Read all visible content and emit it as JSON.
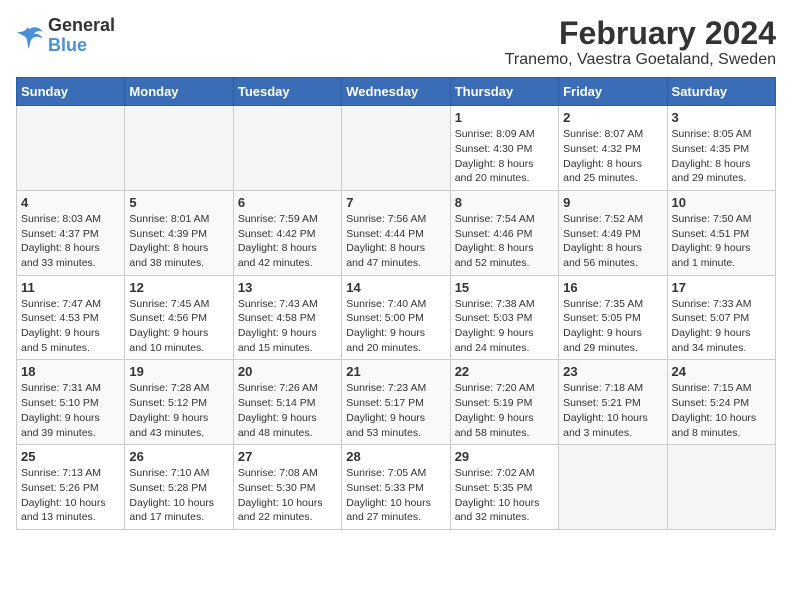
{
  "header": {
    "logo_general": "General",
    "logo_blue": "Blue",
    "title": "February 2024",
    "subtitle": "Tranemo, Vaestra Goetaland, Sweden"
  },
  "weekdays": [
    "Sunday",
    "Monday",
    "Tuesday",
    "Wednesday",
    "Thursday",
    "Friday",
    "Saturday"
  ],
  "weeks": [
    [
      {
        "day": "",
        "info": ""
      },
      {
        "day": "",
        "info": ""
      },
      {
        "day": "",
        "info": ""
      },
      {
        "day": "",
        "info": ""
      },
      {
        "day": "1",
        "info": "Sunrise: 8:09 AM\nSunset: 4:30 PM\nDaylight: 8 hours\nand 20 minutes."
      },
      {
        "day": "2",
        "info": "Sunrise: 8:07 AM\nSunset: 4:32 PM\nDaylight: 8 hours\nand 25 minutes."
      },
      {
        "day": "3",
        "info": "Sunrise: 8:05 AM\nSunset: 4:35 PM\nDaylight: 8 hours\nand 29 minutes."
      }
    ],
    [
      {
        "day": "4",
        "info": "Sunrise: 8:03 AM\nSunset: 4:37 PM\nDaylight: 8 hours\nand 33 minutes."
      },
      {
        "day": "5",
        "info": "Sunrise: 8:01 AM\nSunset: 4:39 PM\nDaylight: 8 hours\nand 38 minutes."
      },
      {
        "day": "6",
        "info": "Sunrise: 7:59 AM\nSunset: 4:42 PM\nDaylight: 8 hours\nand 42 minutes."
      },
      {
        "day": "7",
        "info": "Sunrise: 7:56 AM\nSunset: 4:44 PM\nDaylight: 8 hours\nand 47 minutes."
      },
      {
        "day": "8",
        "info": "Sunrise: 7:54 AM\nSunset: 4:46 PM\nDaylight: 8 hours\nand 52 minutes."
      },
      {
        "day": "9",
        "info": "Sunrise: 7:52 AM\nSunset: 4:49 PM\nDaylight: 8 hours\nand 56 minutes."
      },
      {
        "day": "10",
        "info": "Sunrise: 7:50 AM\nSunset: 4:51 PM\nDaylight: 9 hours\nand 1 minute."
      }
    ],
    [
      {
        "day": "11",
        "info": "Sunrise: 7:47 AM\nSunset: 4:53 PM\nDaylight: 9 hours\nand 5 minutes."
      },
      {
        "day": "12",
        "info": "Sunrise: 7:45 AM\nSunset: 4:56 PM\nDaylight: 9 hours\nand 10 minutes."
      },
      {
        "day": "13",
        "info": "Sunrise: 7:43 AM\nSunset: 4:58 PM\nDaylight: 9 hours\nand 15 minutes."
      },
      {
        "day": "14",
        "info": "Sunrise: 7:40 AM\nSunset: 5:00 PM\nDaylight: 9 hours\nand 20 minutes."
      },
      {
        "day": "15",
        "info": "Sunrise: 7:38 AM\nSunset: 5:03 PM\nDaylight: 9 hours\nand 24 minutes."
      },
      {
        "day": "16",
        "info": "Sunrise: 7:35 AM\nSunset: 5:05 PM\nDaylight: 9 hours\nand 29 minutes."
      },
      {
        "day": "17",
        "info": "Sunrise: 7:33 AM\nSunset: 5:07 PM\nDaylight: 9 hours\nand 34 minutes."
      }
    ],
    [
      {
        "day": "18",
        "info": "Sunrise: 7:31 AM\nSunset: 5:10 PM\nDaylight: 9 hours\nand 39 minutes."
      },
      {
        "day": "19",
        "info": "Sunrise: 7:28 AM\nSunset: 5:12 PM\nDaylight: 9 hours\nand 43 minutes."
      },
      {
        "day": "20",
        "info": "Sunrise: 7:26 AM\nSunset: 5:14 PM\nDaylight: 9 hours\nand 48 minutes."
      },
      {
        "day": "21",
        "info": "Sunrise: 7:23 AM\nSunset: 5:17 PM\nDaylight: 9 hours\nand 53 minutes."
      },
      {
        "day": "22",
        "info": "Sunrise: 7:20 AM\nSunset: 5:19 PM\nDaylight: 9 hours\nand 58 minutes."
      },
      {
        "day": "23",
        "info": "Sunrise: 7:18 AM\nSunset: 5:21 PM\nDaylight: 10 hours\nand 3 minutes."
      },
      {
        "day": "24",
        "info": "Sunrise: 7:15 AM\nSunset: 5:24 PM\nDaylight: 10 hours\nand 8 minutes."
      }
    ],
    [
      {
        "day": "25",
        "info": "Sunrise: 7:13 AM\nSunset: 5:26 PM\nDaylight: 10 hours\nand 13 minutes."
      },
      {
        "day": "26",
        "info": "Sunrise: 7:10 AM\nSunset: 5:28 PM\nDaylight: 10 hours\nand 17 minutes."
      },
      {
        "day": "27",
        "info": "Sunrise: 7:08 AM\nSunset: 5:30 PM\nDaylight: 10 hours\nand 22 minutes."
      },
      {
        "day": "28",
        "info": "Sunrise: 7:05 AM\nSunset: 5:33 PM\nDaylight: 10 hours\nand 27 minutes."
      },
      {
        "day": "29",
        "info": "Sunrise: 7:02 AM\nSunset: 5:35 PM\nDaylight: 10 hours\nand 32 minutes."
      },
      {
        "day": "",
        "info": ""
      },
      {
        "day": "",
        "info": ""
      }
    ]
  ]
}
